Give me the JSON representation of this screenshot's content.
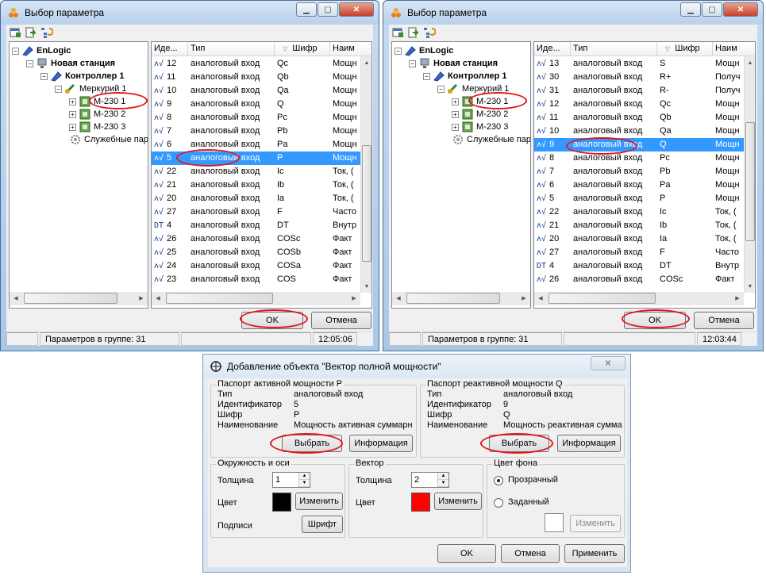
{
  "left_window": {
    "title": "Выбор параметра",
    "tree": {
      "root": "EnLogic",
      "station": "Новая станция",
      "controller": "Контроллер 1",
      "meter": "Меркурий 1",
      "devices": [
        "M-230 1",
        "M-230 2",
        "M-230 3"
      ],
      "service": "Служебные пар"
    },
    "columns": [
      "Иде...",
      "Тип",
      "Шифр",
      "Наим"
    ],
    "rows": [
      {
        "id": "12",
        "type": "аналоговый вход",
        "code": "Qc",
        "name": "Мощн",
        "icon": "wave"
      },
      {
        "id": "11",
        "type": "аналоговый вход",
        "code": "Qb",
        "name": "Мощн",
        "icon": "wave"
      },
      {
        "id": "10",
        "type": "аналоговый вход",
        "code": "Qa",
        "name": "Мощн",
        "icon": "wave"
      },
      {
        "id": "9",
        "type": "аналоговый вход",
        "code": "Q",
        "name": "Мощн",
        "icon": "wave"
      },
      {
        "id": "8",
        "type": "аналоговый вход",
        "code": "Pc",
        "name": "Мощн",
        "icon": "wave"
      },
      {
        "id": "7",
        "type": "аналоговый вход",
        "code": "Pb",
        "name": "Мощн",
        "icon": "wave"
      },
      {
        "id": "6",
        "type": "аналоговый вход",
        "code": "Pa",
        "name": "Мощн",
        "icon": "wave"
      },
      {
        "id": "5",
        "type": "аналоговый вход",
        "code": "P",
        "name": "Мощн",
        "icon": "wave",
        "selected": true
      },
      {
        "id": "22",
        "type": "аналоговый вход",
        "code": "Ic",
        "name": "Ток, (",
        "icon": "wave"
      },
      {
        "id": "21",
        "type": "аналоговый вход",
        "code": "Ib",
        "name": "Ток, (",
        "icon": "wave"
      },
      {
        "id": "20",
        "type": "аналоговый вход",
        "code": "Ia",
        "name": "Ток, (",
        "icon": "wave"
      },
      {
        "id": "27",
        "type": "аналоговый вход",
        "code": "F",
        "name": "Часто",
        "icon": "wave"
      },
      {
        "id": "4",
        "type": "аналоговый вход",
        "code": "DT",
        "name": "Внутр",
        "icon": "dt"
      },
      {
        "id": "26",
        "type": "аналоговый вход",
        "code": "COSc",
        "name": "Факт",
        "icon": "wave"
      },
      {
        "id": "25",
        "type": "аналоговый вход",
        "code": "COSb",
        "name": "Факт",
        "icon": "wave"
      },
      {
        "id": "24",
        "type": "аналоговый вход",
        "code": "COSa",
        "name": "Факт",
        "icon": "wave"
      },
      {
        "id": "23",
        "type": "аналоговый вход",
        "code": "COS",
        "name": "Факт",
        "icon": "wave"
      }
    ],
    "ok": "OK",
    "cancel": "Отмена",
    "status_count": "Параметров в группе: 31",
    "status_time": "12:05:06"
  },
  "right_window": {
    "title": "Выбор параметра",
    "tree": {
      "root": "EnLogic",
      "station": "Новая станция",
      "controller": "Контроллер 1",
      "meter": "Меркурий 1",
      "devices": [
        "M-230 1",
        "M-230 2",
        "M-230 3"
      ],
      "service": "Служебные пар"
    },
    "columns": [
      "Иде...",
      "Тип",
      "Шифр",
      "Наим"
    ],
    "rows": [
      {
        "id": "13",
        "type": "аналоговый вход",
        "code": "S",
        "name": "Мощн",
        "icon": "wave"
      },
      {
        "id": "30",
        "type": "аналоговый вход",
        "code": "R+",
        "name": "Получ",
        "icon": "wave"
      },
      {
        "id": "31",
        "type": "аналоговый вход",
        "code": "R-",
        "name": "Получ",
        "icon": "wave"
      },
      {
        "id": "12",
        "type": "аналоговый вход",
        "code": "Qc",
        "name": "Мощн",
        "icon": "wave"
      },
      {
        "id": "11",
        "type": "аналоговый вход",
        "code": "Qb",
        "name": "Мощн",
        "icon": "wave"
      },
      {
        "id": "10",
        "type": "аналоговый вход",
        "code": "Qa",
        "name": "Мощн",
        "icon": "wave"
      },
      {
        "id": "9",
        "type": "аналоговый вход",
        "code": "Q",
        "name": "Мощн",
        "icon": "wave",
        "selected": true
      },
      {
        "id": "8",
        "type": "аналоговый вход",
        "code": "Pc",
        "name": "Мощн",
        "icon": "wave"
      },
      {
        "id": "7",
        "type": "аналоговый вход",
        "code": "Pb",
        "name": "Мощн",
        "icon": "wave"
      },
      {
        "id": "6",
        "type": "аналоговый вход",
        "code": "Pa",
        "name": "Мощн",
        "icon": "wave"
      },
      {
        "id": "5",
        "type": "аналоговый вход",
        "code": "P",
        "name": "Мощн",
        "icon": "wave"
      },
      {
        "id": "22",
        "type": "аналоговый вход",
        "code": "Ic",
        "name": "Ток, (",
        "icon": "wave"
      },
      {
        "id": "21",
        "type": "аналоговый вход",
        "code": "Ib",
        "name": "Ток, (",
        "icon": "wave"
      },
      {
        "id": "20",
        "type": "аналоговый вход",
        "code": "Ia",
        "name": "Ток, (",
        "icon": "wave"
      },
      {
        "id": "27",
        "type": "аналоговый вход",
        "code": "F",
        "name": "Часто",
        "icon": "wave"
      },
      {
        "id": "4",
        "type": "аналоговый вход",
        "code": "DT",
        "name": "Внутр",
        "icon": "dt"
      },
      {
        "id": "26",
        "type": "аналоговый вход",
        "code": "COSc",
        "name": "Факт",
        "icon": "wave"
      }
    ],
    "ok": "OK",
    "cancel": "Отмена",
    "status_count": "Параметров в группе: 31",
    "status_time": "12:03:44"
  },
  "dialog": {
    "title": "Добавление объекта \"Вектор полной мощности\"",
    "active": {
      "group": "Паспорт активной мощности P",
      "labels": [
        "Тип",
        "Идентификатор",
        "Шифр",
        "Наименование"
      ],
      "values": [
        "аналоговый вход",
        "5",
        "P",
        "Мощность активная суммарн"
      ],
      "select": "Выбрать",
      "info": "Информация"
    },
    "reactive": {
      "group": "Паспорт реактивной мощности Q",
      "labels": [
        "Тип",
        "Идентификатор",
        "Шифр",
        "Наименование"
      ],
      "values": [
        "аналоговый вход",
        "9",
        "Q",
        "Мощность реактивная сумма"
      ],
      "select": "Выбрать",
      "info": "Информация"
    },
    "circle": {
      "group": "Окружность и оси",
      "thickness_label": "Толщина",
      "thickness": "1",
      "color_label": "Цвет",
      "color": "#000000",
      "change": "Изменить",
      "captions_label": "Подписи",
      "font": "Шрифт"
    },
    "vector": {
      "group": "Вектор",
      "thickness_label": "Толщина",
      "thickness": "2",
      "color_label": "Цвет",
      "color": "#ff0000",
      "change": "Изменить"
    },
    "background": {
      "group": "Цвет фона",
      "transparent": "Прозрачный",
      "custom": "Заданный",
      "change": "Изменить",
      "selected": "transparent"
    },
    "ok": "OK",
    "cancel": "Отмена",
    "apply": "Применить"
  }
}
